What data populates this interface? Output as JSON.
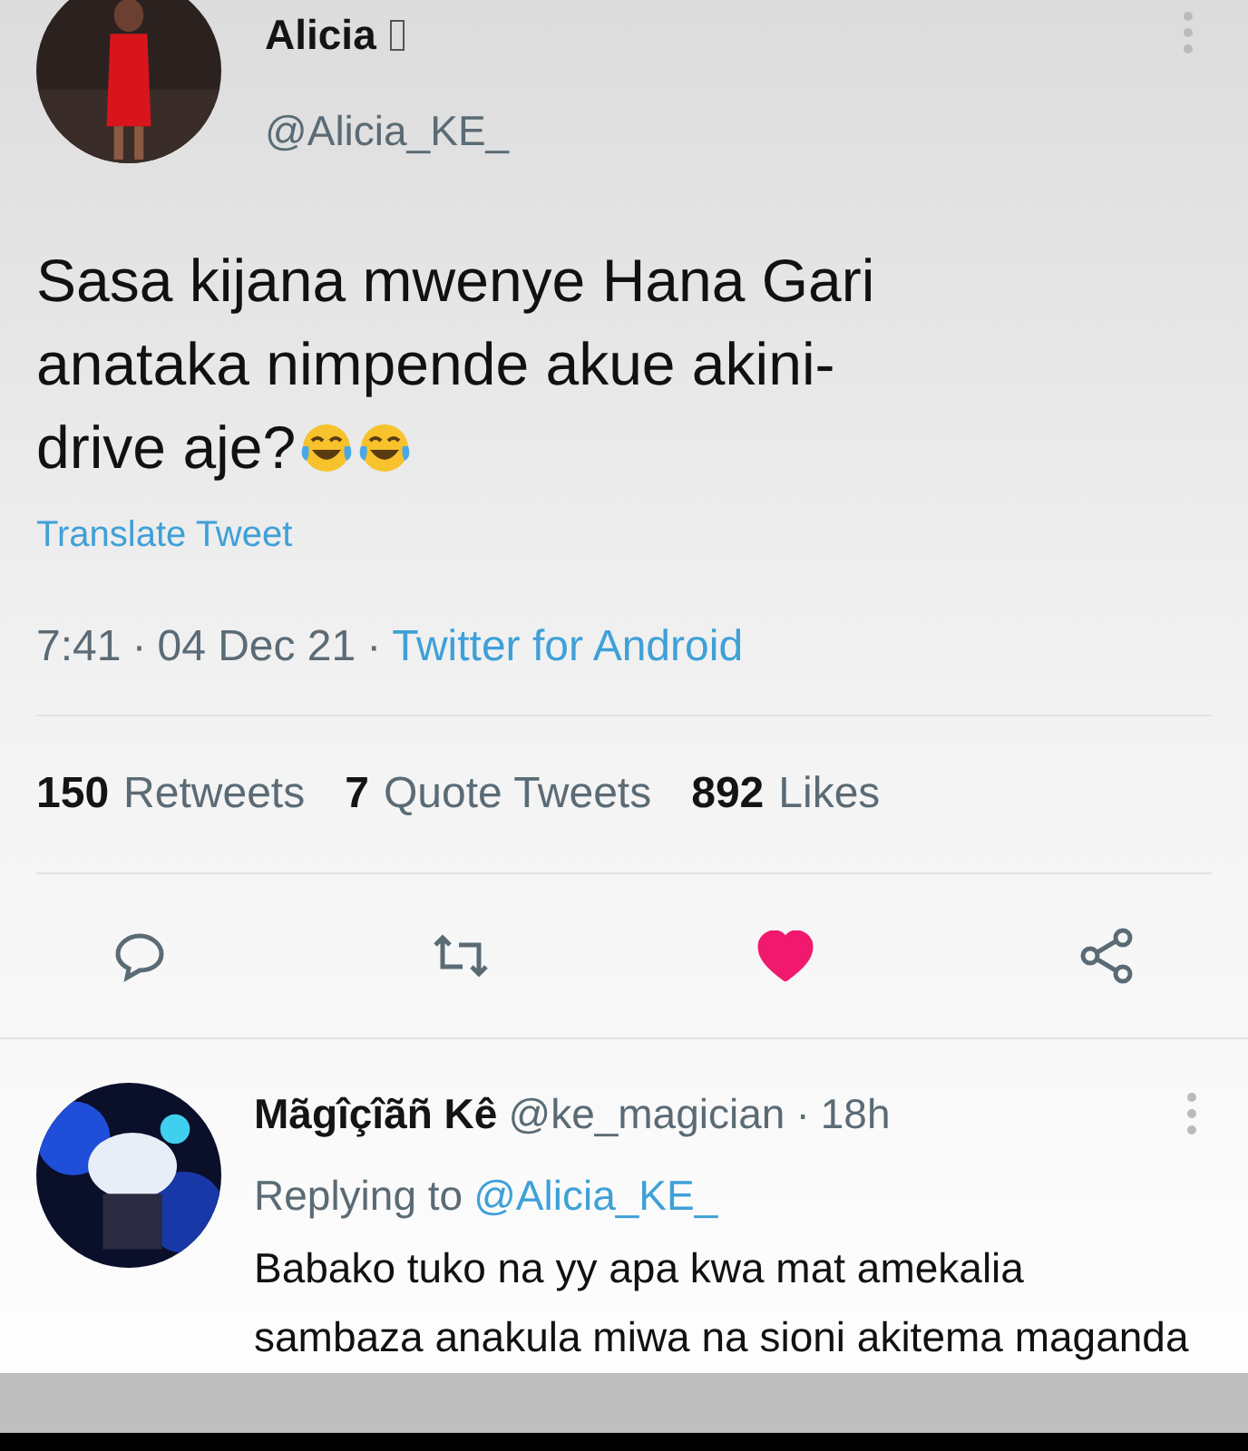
{
  "tweet": {
    "name": "Alicia",
    "handle": "@Alicia_KE_",
    "text": "Sasa kijana mwenye Hana Gari anataka nimpende akue akini-drive aje?",
    "translate": "Translate Tweet",
    "time": "7:41",
    "date": "04 Dec 21",
    "source": "Twitter for Android",
    "stats": [
      {
        "count": "150",
        "label": "Retweets"
      },
      {
        "count": "7",
        "label": "Quote Tweets"
      },
      {
        "count": "892",
        "label": "Likes"
      }
    ],
    "liked": true,
    "separator": "·"
  },
  "reply": {
    "name": "Mãgîçîãñ Kê",
    "handle": "@ke_magician",
    "age": "18h",
    "separator": "·",
    "replying_prefix": "Replying to",
    "replying_to": "@Alicia_KE_",
    "text": "Babako tuko na yy apa kwa mat amekalia sambaza anakula miwa na sioni akitema maganda"
  }
}
